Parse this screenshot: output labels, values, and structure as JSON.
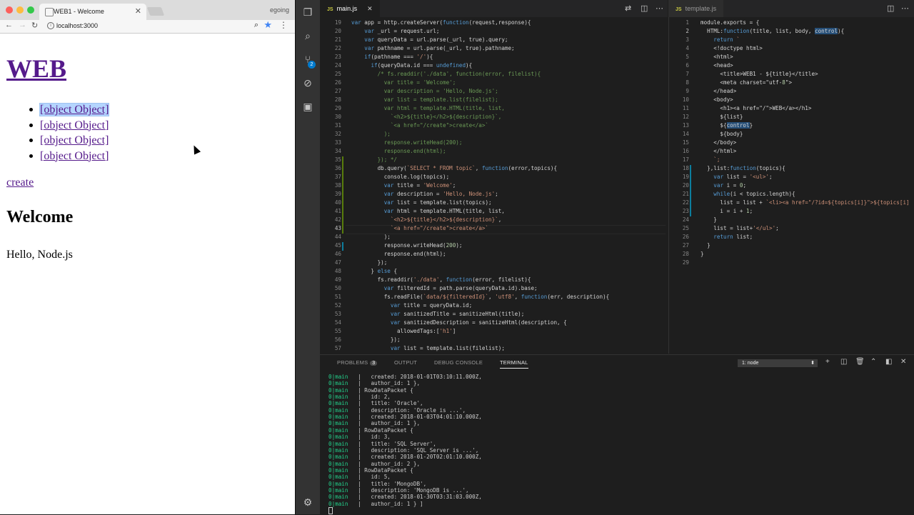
{
  "browser": {
    "tab_title": "WEB1 - Welcome",
    "user": "egoing",
    "url": "localhost:3000",
    "page": {
      "h1": "WEB",
      "list_items": [
        "[object Object]",
        "[object Object]",
        "[object Object]",
        "[object Object]"
      ],
      "create_link": "create",
      "h2": "Welcome",
      "paragraph": "Hello, Node.js"
    }
  },
  "editor": {
    "left_tab": "main.js",
    "right_tab": "template.js",
    "left_lines_start": 19,
    "left_cursor_line": 43,
    "right_cursor_line": 2,
    "left_code": [
      "var app = http.createServer(function(request,response){",
      "    var _url = request.url;",
      "    var queryData = url.parse(_url, true).query;",
      "    var pathname = url.parse(_url, true).pathname;",
      "    if(pathname === '/'){",
      "      if(queryData.id === undefined){",
      "        /* fs.readdir('./data', function(error, filelist){",
      "          var title = 'Welcome';",
      "          var description = 'Hello, Node.js';",
      "          var list = template.list(filelist);",
      "          var html = template.HTML(title, list,",
      "            `<h2>${title}</h2>${description}`,",
      "            `<a href=\"/create\">create</a>`",
      "          );",
      "          response.writeHead(200);",
      "          response.end(html);",
      "        }); */",
      "        db.query(`SELECT * FROM topic`, function(error,topics){",
      "          console.log(topics);",
      "          var title = 'Welcome';",
      "          var description = 'Hello, Node.js';",
      "          var list = template.list(topics);",
      "          var html = template.HTML(title, list,",
      "            `<h2>${title}</h2>${description}`,",
      "            `<a href=\"/create\">create</a>`",
      "          );",
      "          response.writeHead(200);",
      "          response.end(html);",
      "        });",
      "      } else {",
      "        fs.readdir('./data', function(error, filelist){",
      "          var filteredId = path.parse(queryData.id).base;",
      "          fs.readFile(`data/${filteredId}`, 'utf8', function(err, description){",
      "            var title = queryData.id;",
      "            var sanitizedTitle = sanitizeHtml(title);",
      "            var sanitizedDescription = sanitizeHtml(description, {",
      "              allowedTags:['h1']",
      "            });",
      "            var list = template.list(filelist);"
    ],
    "right_code": [
      "module.exports = {",
      "  HTML:function(title, list, body, control){",
      "    return `",
      "    <!doctype html>",
      "    <html>",
      "    <head>",
      "      <title>WEB1 - ${title}</title>",
      "      <meta charset=\"utf-8\">",
      "    </head>",
      "    <body>",
      "      <h1><a href=\"/\">WEB</a></h1>",
      "      ${list}",
      "      ${control}",
      "      ${body}",
      "    </body>",
      "    </html>",
      "    `;",
      "  },list:function(topics){",
      "    var list = '<ul>';",
      "    var i = 0;",
      "    while(i < topics.length){",
      "      list = list + `<li><a href=\"/?id=${topics[i]}\">${topics[i]",
      "      i = i + 1;",
      "    }",
      "    list = list+'</ul>';",
      "    return list;",
      "  }",
      "}",
      ""
    ]
  },
  "panel": {
    "tabs": [
      {
        "label": "PROBLEMS",
        "badge": "3"
      },
      {
        "label": "OUTPUT"
      },
      {
        "label": "DEBUG CONSOLE"
      },
      {
        "label": "TERMINAL"
      }
    ],
    "terminal_select": "1: node",
    "terminal_prefix": "0|main   |",
    "terminal_lines": [
      "   created: 2018-01-01T03:10:11.000Z,",
      "   author_id: 1 },",
      " RowDataPacket {",
      "   id: 2,",
      "   title: 'Oracle',",
      "   description: 'Oracle is ...',",
      "   created: 2018-01-03T04:01:10.000Z,",
      "   author_id: 1 },",
      " RowDataPacket {",
      "   id: 3,",
      "   title: 'SQL Server',",
      "   description: 'SQL Server is ...',",
      "   created: 2018-01-20T02:01:10.000Z,",
      "   author_id: 2 },",
      " RowDataPacket {",
      "   id: 5,",
      "   title: 'MongoDB',",
      "   description: 'MongoDB is ...',",
      "   created: 2018-01-30T03:31:03.000Z,",
      "   author_id: 1 } ]"
    ]
  }
}
